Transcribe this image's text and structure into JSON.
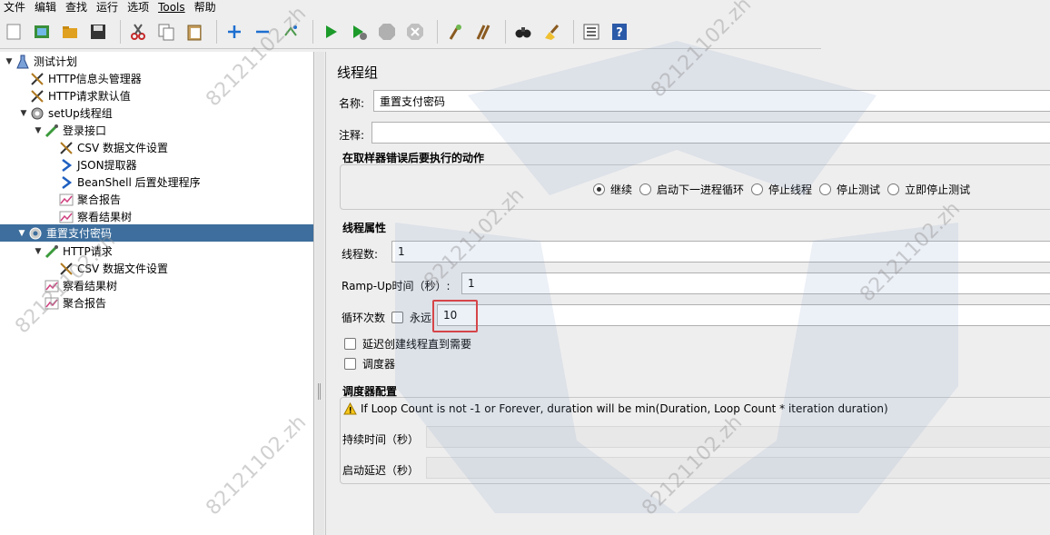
{
  "menu": [
    "文件",
    "编辑",
    "查找",
    "运行",
    "选项",
    "Tools",
    "帮助"
  ],
  "toolbar": {
    "icons": [
      "new-icon",
      "templates-icon",
      "open-icon",
      "save-icon",
      "cut-icon",
      "copy-icon",
      "paste-icon",
      "expand-icon",
      "collapse-icon",
      "toggle-icon",
      "start-icon",
      "start-no-pause-icon",
      "stop-icon",
      "shutdown-icon",
      "clear-icon",
      "clear-all-icon",
      "search-icon",
      "reset-search-icon",
      "function-helper-icon",
      "help-icon"
    ]
  },
  "tree": {
    "nodes": [
      {
        "label": "测试计划",
        "icon": "test-plan-icon",
        "toggle": "▼"
      },
      {
        "label": "HTTP信息头管理器",
        "icon": "config-tool-icon",
        "toggle": ""
      },
      {
        "label": "HTTP请求默认值",
        "icon": "config-tool-icon",
        "toggle": ""
      },
      {
        "label": "setUp线程组",
        "icon": "gear-icon",
        "toggle": "▼"
      },
      {
        "label": "登录接口",
        "icon": "sampler-icon",
        "toggle": "▼"
      },
      {
        "label": "CSV 数据文件设置",
        "icon": "config-tool-icon",
        "toggle": ""
      },
      {
        "label": "JSON提取器",
        "icon": "extractor-icon",
        "toggle": ""
      },
      {
        "label": "BeanShell 后置处理程序",
        "icon": "extractor-icon",
        "toggle": ""
      },
      {
        "label": "聚合报告",
        "icon": "listener-icon",
        "toggle": ""
      },
      {
        "label": "察看结果树",
        "icon": "listener-icon",
        "toggle": ""
      },
      {
        "label": "重置支付密码",
        "icon": "gear-icon",
        "toggle": "▼"
      },
      {
        "label": "HTTP请求",
        "icon": "sampler-icon",
        "toggle": "▼"
      },
      {
        "label": "CSV 数据文件设置",
        "icon": "config-tool-icon",
        "toggle": ""
      },
      {
        "label": "察看结果树",
        "icon": "listener-icon",
        "toggle": ""
      },
      {
        "label": "聚合报告",
        "icon": "listener-icon",
        "toggle": ""
      }
    ]
  },
  "panel": {
    "title": "线程组",
    "name_label": "名称:",
    "name_value": "重置支付密码",
    "comment_label": "注释:",
    "comment_value": "",
    "error_section_title": "在取样器错误后要执行的动作",
    "error_options": [
      {
        "label": "继续",
        "selected": true
      },
      {
        "label": "启动下一进程循环",
        "selected": false
      },
      {
        "label": "停止线程",
        "selected": false
      },
      {
        "label": "停止测试",
        "selected": false
      },
      {
        "label": "立即停止测试",
        "selected": false
      }
    ],
    "thread_section_title": "线程属性",
    "threads_label": "线程数:",
    "threads_value": "1",
    "rampup_label": "Ramp-Up时间（秒）:",
    "rampup_value": "1",
    "loop_label": "循环次数",
    "forever_label": "永远",
    "loop_value": "10",
    "delay_label": "延迟创建线程直到需要",
    "scheduler_label": "调度器",
    "scheduler_section_title": "调度器配置",
    "warning_text": "If Loop Count is not -1 or Forever, duration will be min(Duration, Loop Count * iteration duration)",
    "duration_label": "持续时间（秒）",
    "startup_delay_label": "启动延迟（秒）"
  },
  "watermark": {
    "text": "82121102.zh"
  },
  "colors": {
    "selection": "#3d6e9d",
    "highlight": "#e53935"
  }
}
